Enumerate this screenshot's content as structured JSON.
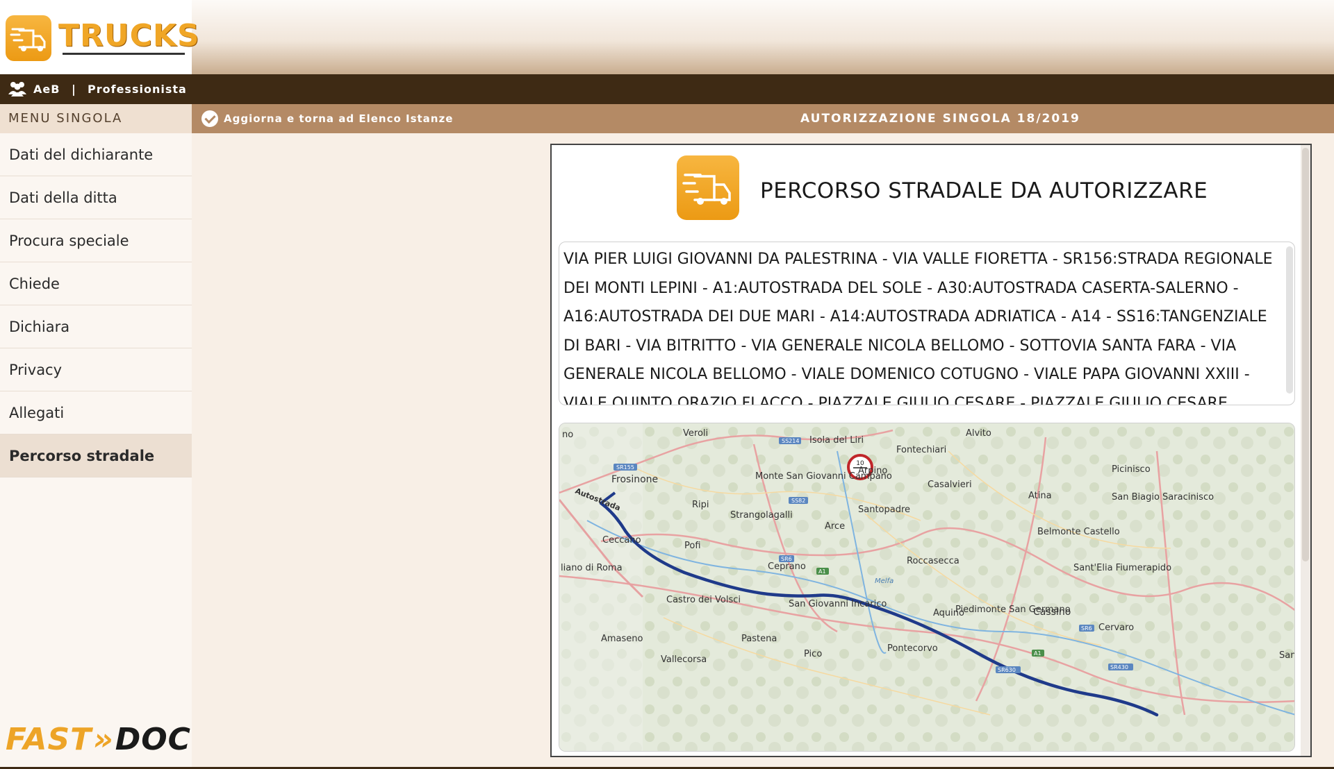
{
  "brand": {
    "app_name": "TRUCKS",
    "footer_logo_fast": "FAST",
    "footer_logo_doc": "DOC"
  },
  "user": {
    "name": "AeB",
    "separator": "|",
    "role": "Professionista"
  },
  "toolbar": {
    "update_label": "Aggiorna e torna ad Elenco Istanze",
    "title": "AUTORIZZAZIONE SINGOLA 18/2019"
  },
  "sidebar": {
    "header": "MENU SINGOLA",
    "items": [
      {
        "label": "Dati del dichiarante"
      },
      {
        "label": "Dati della ditta"
      },
      {
        "label": "Procura speciale"
      },
      {
        "label": "Chiede"
      },
      {
        "label": "Dichiara"
      },
      {
        "label": "Privacy"
      },
      {
        "label": "Allegati"
      },
      {
        "label": "Percorso stradale"
      }
    ],
    "active_index": 7
  },
  "section": {
    "title": "PERCORSO STRADALE DA AUTORIZZARE",
    "route_text": "VIA PIER LUIGI GIOVANNI DA PALESTRINA - VIA VALLE FIORETTA - SR156:STRADA REGIONALE DEI MONTI LEPINI - A1:AUTOSTRADA DEL SOLE - A30:AUTOSTRADA CASERTA-SALERNO - A16:AUTOSTRADA DEI DUE MARI - A14:AUTOSTRADA ADRIATICA - A14 - SS16:TANGENZIALE DI BARI - VIA BITRITTO - VIA GENERALE NICOLA BELLOMO - SOTTOVIA SANTA FARA - VIA GENERALE NICOLA BELLOMO - VIALE DOMENICO COTUGNO - VIALE PAPA GIOVANNI XXIII - VIALE QUINTO ORAZIO FLACCO - PIAZZALE GIULIO CESARE - PIAZZALE GIULIO CESARE"
  },
  "map": {
    "places": [
      "no",
      "Veroli",
      "Isola del Liri",
      "Alvito",
      "Fontechiari",
      "Frosinone",
      "Monte San Giovanni Campano",
      "Arpino",
      "Casalvieri",
      "Picinisco",
      "Atina",
      "San Biagio Saracinisco",
      "Ripi",
      "Strangolagalli",
      "Santopadre",
      "Arce",
      "Belmonte Castello",
      "Ceccano",
      "Pofi",
      "Roccasecca",
      "liano di Roma",
      "Ceprano",
      "Sant'Elia Fiumerapido",
      "Castro dei Volsci",
      "San Giovanni Incarico",
      "Piedimonte San Germano",
      "Aquino",
      "Cassino",
      "Cervaro",
      "Amaseno",
      "Pastena",
      "Pontecorvo",
      "Pico",
      "Vallecorsa",
      "San",
      "Autostrada",
      "Melfa"
    ],
    "road_badges": [
      "SS214",
      "SR155",
      "SS82",
      "SR6",
      "A1",
      "SR6",
      "A1",
      "SR630",
      "SR430"
    ],
    "route_color": "#1f3a8a",
    "speed_sign": "10"
  },
  "colors": {
    "accent": "#f0a626",
    "dark_brown": "#3e2a14",
    "tan": "#b48a65"
  }
}
